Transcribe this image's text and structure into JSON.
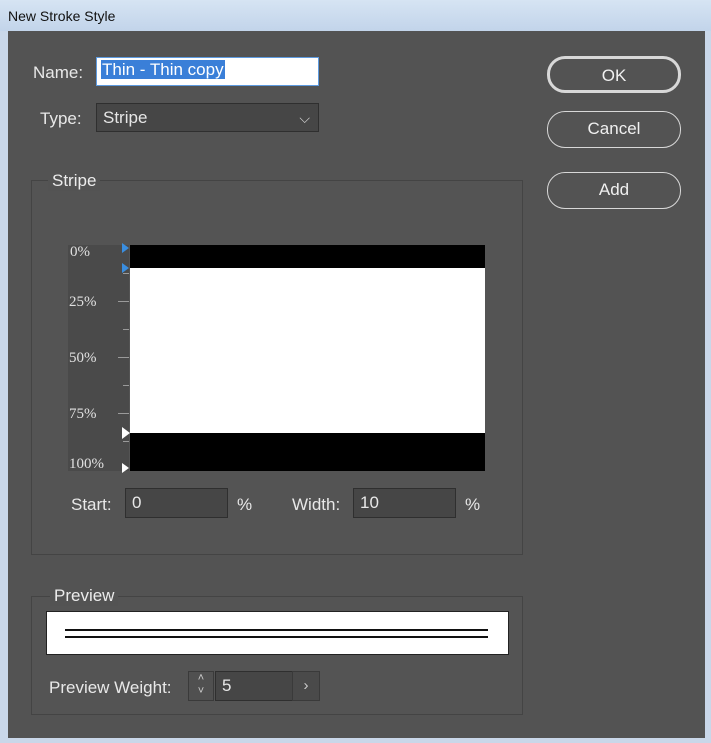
{
  "window": {
    "title": "New Stroke Style"
  },
  "form": {
    "name_label": "Name:",
    "name_value": "Thin - Thin copy",
    "type_label": "Type:",
    "type_value": "Stripe"
  },
  "buttons": {
    "ok": "OK",
    "cancel": "Cancel",
    "add": "Add"
  },
  "stripe": {
    "section_title": "Stripe",
    "ruler_labels": [
      "0%",
      "25%",
      "50%",
      "75%",
      "100%"
    ],
    "stripes_percent": [
      {
        "start": 0,
        "width": 10
      },
      {
        "start": 83,
        "width": 17
      }
    ],
    "start_label": "Start:",
    "start_value": "0",
    "start_unit": "%",
    "width_label": "Width:",
    "width_value": "10",
    "width_unit": "%"
  },
  "preview": {
    "section_title": "Preview",
    "weight_label": "Preview Weight:",
    "weight_value": "5"
  },
  "colors": {
    "accent": "#3a7fd8",
    "background": "#535353",
    "marker_selected": "#3a8ee0"
  }
}
